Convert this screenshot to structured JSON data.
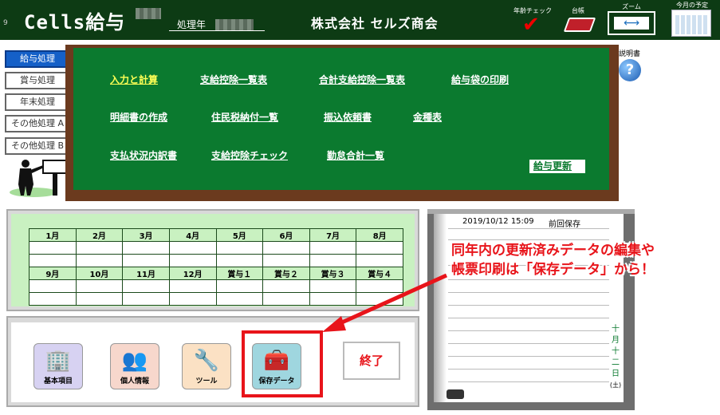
{
  "header": {
    "version": "9",
    "app_title": "Cells給与",
    "year_label": "処理年",
    "company": "株式会社 セルズ商会",
    "age_check": "年齢チェック",
    "ledger": "台帳",
    "zoom": "ズーム",
    "month_plan": "今月の予定"
  },
  "icons": {
    "age_check": "red-check-icon",
    "ledger": "red-book-icon",
    "zoom": "zoom-arrows-icon",
    "plan": "calendar-icon",
    "help": "question-icon"
  },
  "sidebar": {
    "items": [
      {
        "label": "給与処理",
        "active": true
      },
      {
        "label": "賞与処理"
      },
      {
        "label": "年末処理"
      },
      {
        "label": "その他処理 A"
      },
      {
        "label": "その他処理 B"
      }
    ]
  },
  "board": {
    "rows": [
      [
        "入力と計算",
        "支給控除一覧表",
        "合計支給控除一覧表",
        "給与袋の印刷"
      ],
      [
        "明細書の作成",
        "住民税納付一覧",
        "振込依頼書",
        "金種表"
      ],
      [
        "支払状況内訳書",
        "支給控除チェック",
        "勤怠合計一覧"
      ]
    ],
    "update": "給与更新",
    "help_label": "説明書"
  },
  "months": {
    "row1": [
      "1月",
      "2月",
      "3月",
      "4月",
      "5月",
      "6月",
      "7月",
      "8月"
    ],
    "row2": [
      "9月",
      "10月",
      "11月",
      "12月",
      "賞与１",
      "賞与２",
      "賞与３",
      "賞与４"
    ]
  },
  "actions": {
    "basic": "基本項目",
    "personal": "個人情報",
    "tools": "ツール",
    "save_data": "保存データ",
    "exit": "終了"
  },
  "scroll": {
    "save_date": "2019/10/12 15:09",
    "prev_save": "前回保存",
    "vertical_date": [
      "十",
      "月",
      "十",
      "二",
      "日",
      "(土)"
    ]
  },
  "annotation": {
    "line1": "同年内の更新済みデータの編集や",
    "line2": "帳票印刷は「保存データ」から！"
  }
}
